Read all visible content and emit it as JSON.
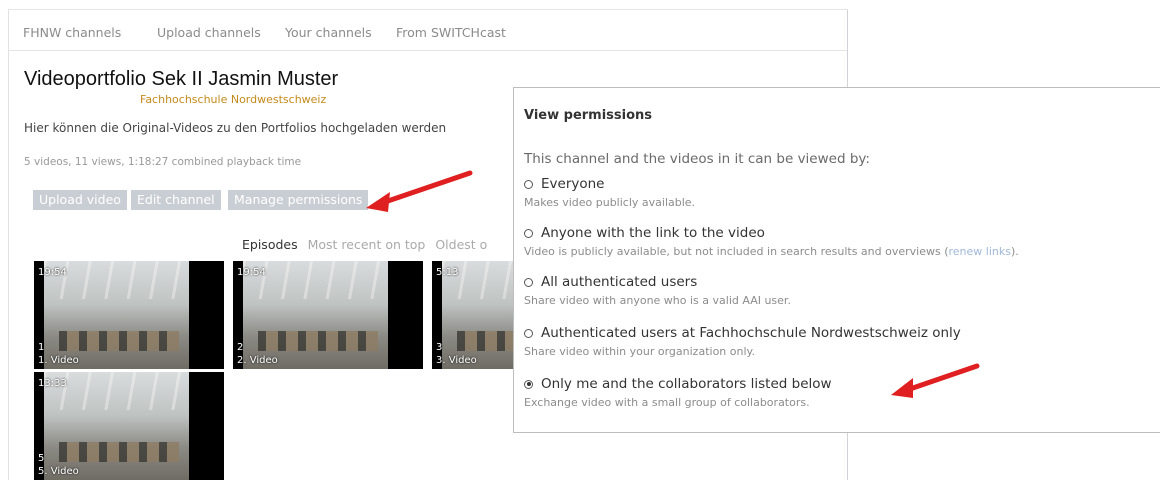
{
  "tabs": [
    "FHNW channels",
    "Upload channels",
    "Your channels",
    "From SWITCHcast"
  ],
  "channel": {
    "title": "Videoportfolio Sek II Jasmin Muster",
    "organization": "Fachhochschule Nordwestschweiz",
    "description": "Hier können die Original-Videos zu den Portfolios hochgeladen werden",
    "stats": "5 videos, 11 views, 1:18:27 combined playback time"
  },
  "actions": {
    "upload": "Upload video",
    "edit": "Edit channel",
    "permissions": "Manage permissions"
  },
  "sort": {
    "active": "Episodes",
    "options": [
      "Most recent on top",
      "Oldest o"
    ]
  },
  "videos": [
    {
      "duration": "19:54",
      "number": "1",
      "title": "1. Video"
    },
    {
      "duration": "19:54",
      "number": "2",
      "title": "2. Video"
    },
    {
      "duration": "5:13",
      "number": "3",
      "title": "3. Video"
    },
    {
      "duration": "13:33",
      "number": "5",
      "title": "5. Video"
    }
  ],
  "permissions": {
    "title": "View permissions",
    "intro": "This channel and the videos in it can be viewed by:",
    "options": [
      {
        "label": "Everyone",
        "description": "Makes video publicly available.",
        "checked": false
      },
      {
        "label": "Anyone with the link to the video",
        "description": "Video is publicly available, but not included in search results and overviews (",
        "link": "renew links",
        "suffix": ").",
        "checked": false
      },
      {
        "label": "All authenticated users",
        "description": "Share video with anyone who is a valid AAI user.",
        "checked": false
      },
      {
        "label": "Authenticated users at Fachhochschule Nordwestschweiz only",
        "description": "Share video within your organization only.",
        "checked": false
      },
      {
        "label": "Only me and the collaborators listed below",
        "description": "Exchange video with a small group of collaborators.",
        "checked": true
      }
    ]
  },
  "colors": {
    "accent_org": "#c58a1c",
    "button_bg": "#c9ced4",
    "arrow": "#e02020",
    "link": "#9fb8d9"
  }
}
